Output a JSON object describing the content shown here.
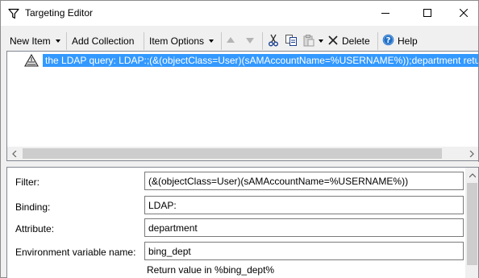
{
  "window": {
    "title": "Targeting Editor",
    "title_icon": "filter-funnel-icon",
    "controls": [
      "minimize-icon",
      "maximize-icon",
      "close-icon"
    ]
  },
  "toolbar": {
    "new_item_label": "New Item",
    "add_collection_label": "Add Collection",
    "item_options_label": "Item Options",
    "delete_label": "Delete",
    "help_label": "Help",
    "icons": [
      "move-up-icon",
      "move-down-icon",
      "cut-icon",
      "copy-icon",
      "paste-icon",
      "delete-icon",
      "help-icon"
    ]
  },
  "tree": {
    "items": [
      {
        "icon": "ldap-query-icon",
        "label": "the LDAP query: LDAP:;(&(objectClass=User)(sAMAccountName=%USERNAME%));department returns"
      }
    ]
  },
  "properties": {
    "filter": {
      "label": "Filter:",
      "value": "(&(objectClass=User)(sAMAccountName=%USERNAME%))"
    },
    "binding": {
      "label": "Binding:",
      "value": "LDAP:"
    },
    "attribute": {
      "label": "Attribute:",
      "value": "department"
    },
    "env_var": {
      "label": "Environment variable name:",
      "value": "bing_dept"
    },
    "note": "Return value in %bing_dept%"
  },
  "colors": {
    "selection": "#3399ff",
    "help_blue": "#1e6fc8",
    "background": "#f0f0f0"
  }
}
